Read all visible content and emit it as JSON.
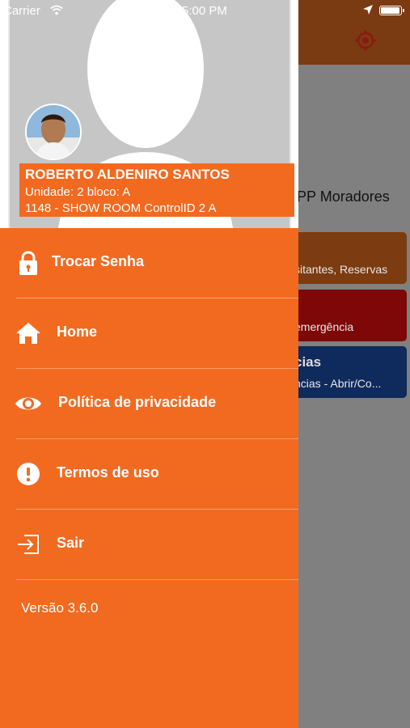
{
  "status_bar": {
    "carrier": "Carrier",
    "time": "5:00 PM"
  },
  "background": {
    "title": "APP Moradores",
    "cards": [
      {
        "title": "",
        "subtitle": "sitantes, Reservas",
        "color": "#7c3b10"
      },
      {
        "title": "",
        "subtitle": "emergência",
        "color": "#7e0808"
      },
      {
        "title": "cias",
        "subtitle": "ncias - Abrir/Co...",
        "color": "#0f2a5c"
      }
    ]
  },
  "profile": {
    "name": "ROBERTO ALDENIRO SANTOS",
    "unit": "Unidade: 2 bloco: A",
    "condominium": "1148 - SHOW ROOM ControlID 2 A"
  },
  "menu": {
    "items": [
      {
        "label": "Trocar Senha",
        "icon": "lock-icon"
      },
      {
        "label": "Home",
        "icon": "home-icon"
      },
      {
        "label": "Política de privacidade",
        "icon": "eye-icon"
      },
      {
        "label": "Termos de uso",
        "icon": "alert-icon"
      },
      {
        "label": "Sair",
        "icon": "logout-icon"
      }
    ],
    "version": "Versão 3.6.0"
  },
  "colors": {
    "accent": "#f26a20",
    "header_dim": "#7a3a12"
  }
}
